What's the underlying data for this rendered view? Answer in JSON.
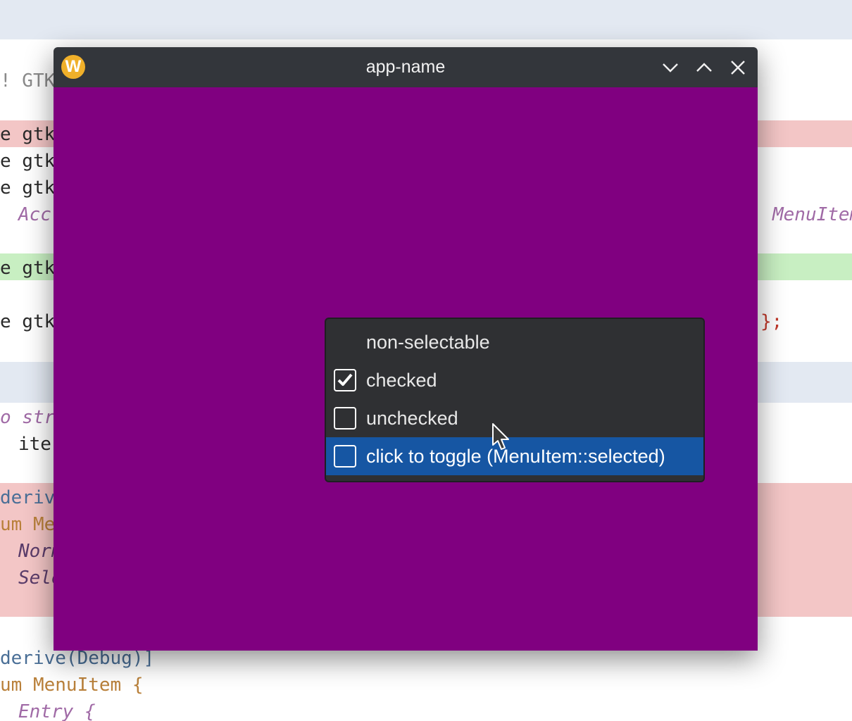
{
  "window": {
    "title": "app-name",
    "logo_letter": "W",
    "content_color": "#800080"
  },
  "menu": {
    "items": [
      {
        "label": "non-selectable",
        "type": "plain"
      },
      {
        "label": "checked",
        "type": "checkbox",
        "checked": true
      },
      {
        "label": "unchecked",
        "type": "checkbox",
        "checked": false
      },
      {
        "label": "click to toggle (MenuItem::selected)",
        "type": "checkbox",
        "checked": false,
        "hovered": true
      }
    ]
  },
  "background_code": {
    "left_fragments": [
      "! GTK",
      "e gtk",
      "e gtk",
      "e gtk",
      "Acc",
      "e gtk",
      "e gtk",
      "o stru",
      "iter",
      "derive",
      "um Men",
      "Norm",
      "Sele",
      "derive(Debug)]",
      "um MenuItem {",
      "Entry {"
    ],
    "right_fragments": [
      "MenuItem",
      "};"
    ]
  },
  "icons": {
    "minimize": "chevron-down-icon",
    "maximize": "chevron-up-icon",
    "close": "close-icon",
    "check": "check-icon",
    "cursor": "pointer-cursor-icon"
  }
}
